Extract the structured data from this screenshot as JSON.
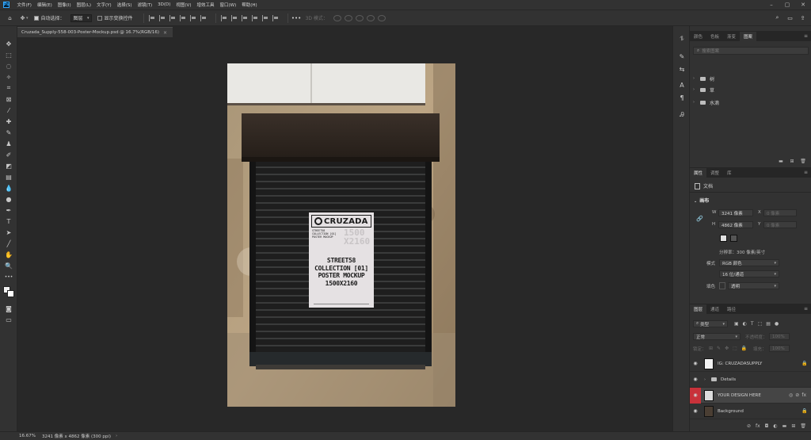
{
  "menu": [
    "文件(F)",
    "编辑(E)",
    "图像(I)",
    "图层(L)",
    "文字(Y)",
    "选择(S)",
    "滤镜(T)",
    "3D(D)",
    "视图(V)",
    "增效工具",
    "窗口(W)",
    "帮助(H)"
  ],
  "options": {
    "auto_select_label": "自动选择：",
    "auto_select_value": "图层",
    "transform_label": "显示变换控件",
    "mode_3d_label": "3D 模式："
  },
  "document_tab": {
    "title": "Cruzada_Supply-558-003-Poster-Mockup.psd @ 16.7%(RGB/16)",
    "close": "×"
  },
  "status": {
    "zoom": "16.67%",
    "info": "3241 像素 x 4862 像素 (300 ppi)",
    "arrow": "›"
  },
  "libraries": {
    "tabs": [
      "颜色",
      "色板",
      "渐变",
      "图案"
    ],
    "active_tab": 3,
    "search_placeholder": "搜索图案",
    "groups": [
      "树",
      "草",
      "水滴"
    ]
  },
  "properties": {
    "tabs": [
      "属性",
      "调整",
      "库"
    ],
    "doc_label": "文档",
    "section": "画布",
    "w_label": "W",
    "w_value": "3241 像素",
    "x_label": "X",
    "x_placeholder": "0 像素",
    "h_label": "H",
    "h_value": "4862 像素",
    "y_label": "Y",
    "y_placeholder": "0 像素",
    "resolution": "分辨率：300 像素/英寸",
    "mode_label": "模式",
    "mode_value": "RGB 颜色",
    "depth_value": "16 位/通道",
    "fill_label": "填色",
    "fill_value": "透明"
  },
  "layers": {
    "tabs": [
      "图层",
      "通道",
      "路径"
    ],
    "filter_value": "类型",
    "blend_mode": "正常",
    "opacity_label": "不透明度：",
    "opacity_value": "100%",
    "lock_label": "锁定：",
    "fill_label": "填充：",
    "fill_value": "100%",
    "rows": [
      {
        "name": "IG: CRUZADASUPPLY",
        "locked": true
      },
      {
        "name": "Details",
        "folder": true
      },
      {
        "name": "YOUR DESIGN HERE",
        "smart": true
      },
      {
        "name": "Background",
        "locked": true
      }
    ]
  },
  "poster": {
    "brand": "CRUZADA",
    "small_lines": [
      "STREET58",
      "COLLECTION [01]",
      "POSTER MOCKUP"
    ],
    "size_big": "1500\nX2160",
    "main_lines": [
      "STREET58",
      "COLLECTION [01]",
      "POSTER MOCKUP",
      "1500X2160"
    ]
  },
  "colors": {
    "accent_red": "#c8323a",
    "panel_bg": "#323232",
    "canvas_bg": "#282828"
  }
}
